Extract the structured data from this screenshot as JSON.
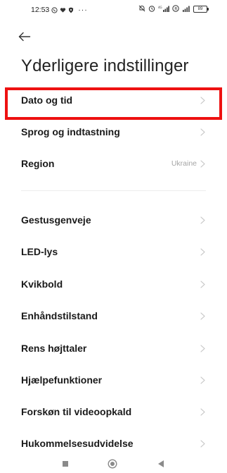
{
  "status_bar": {
    "time": "12:53",
    "left_icons": [
      "whatsapp-icon",
      "heart-icon",
      "shield-icon",
      "more-dots-icon"
    ],
    "more_dots": "···",
    "right_icons": [
      "mute-icon",
      "alarm-icon",
      "signal-icon",
      "r-icon",
      "signal-icon"
    ],
    "battery": "89"
  },
  "header": {
    "back_icon": "arrow-left-icon",
    "title": "Yderligere indstillinger"
  },
  "settings": {
    "items": [
      {
        "label": "Dato og tid",
        "value": ""
      },
      {
        "label": "Sprog og indtastning",
        "value": ""
      },
      {
        "label": "Region",
        "value": "Ukraine"
      },
      {
        "label": "Gestusgenveje",
        "value": ""
      },
      {
        "label": "LED-lys",
        "value": ""
      },
      {
        "label": "Kvikbold",
        "value": ""
      },
      {
        "label": "Enhåndstilstand",
        "value": ""
      },
      {
        "label": "Rens højttaler",
        "value": ""
      },
      {
        "label": "Hjælpefunktioner",
        "value": ""
      },
      {
        "label": "Forskøn til videoopkald",
        "value": ""
      },
      {
        "label": "Hukommelsesudvidelse",
        "value": ""
      }
    ]
  },
  "highlight": {
    "color": "#ee1111",
    "target": "Dato og tid"
  },
  "nav_bar": {
    "buttons": [
      "recents-square-icon",
      "home-circle-icon",
      "back-triangle-icon"
    ]
  },
  "colors": {
    "background": "#ffffff",
    "text": "#1a1a1a",
    "secondary_text": "#a5a5a5",
    "chevron": "#c4c4c4",
    "accent": "#ee1111"
  }
}
